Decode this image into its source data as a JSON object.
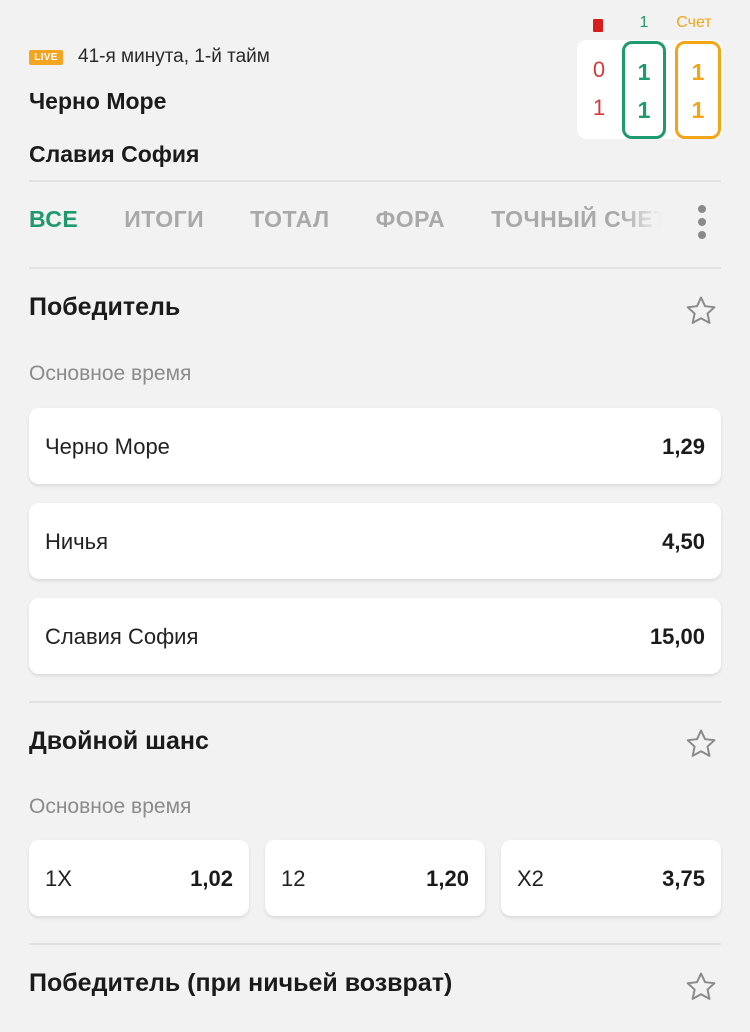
{
  "match": {
    "live_badge": "LIVE",
    "status": "41-я минута, 1-й тайм",
    "team1": "Черно Море",
    "team2": "Славия София"
  },
  "scoreboard": {
    "head_period": "1",
    "head_score": "Счет",
    "red_cards": [
      "0",
      "1"
    ],
    "period_scores": [
      "1",
      "1"
    ],
    "total_scores": [
      "1",
      "1"
    ],
    "colors": {
      "green": "#1e9a6c",
      "orange": "#f2a516",
      "red": "#d33a3a"
    }
  },
  "tabs": [
    "ВСЕ",
    "ИТОГИ",
    "ТОТАЛ",
    "ФОРА",
    "ТОЧНЫЙ СЧЕТ"
  ],
  "active_tab": "ВСЕ",
  "sections": [
    {
      "title": "Победитель",
      "subtitle": "Основное время",
      "outcomes": [
        {
          "label": "Черно Море",
          "odds": "1,29"
        },
        {
          "label": "Ничья",
          "odds": "4,50"
        },
        {
          "label": "Славия София",
          "odds": "15,00"
        }
      ]
    },
    {
      "title": "Двойной шанс",
      "subtitle": "Основное время",
      "outcomes": [
        {
          "label": "1X",
          "odds": "1,02"
        },
        {
          "label": "12",
          "odds": "1,20"
        },
        {
          "label": "X2",
          "odds": "3,75"
        }
      ]
    },
    {
      "title": "Победитель (при ничьей возврат)"
    }
  ]
}
